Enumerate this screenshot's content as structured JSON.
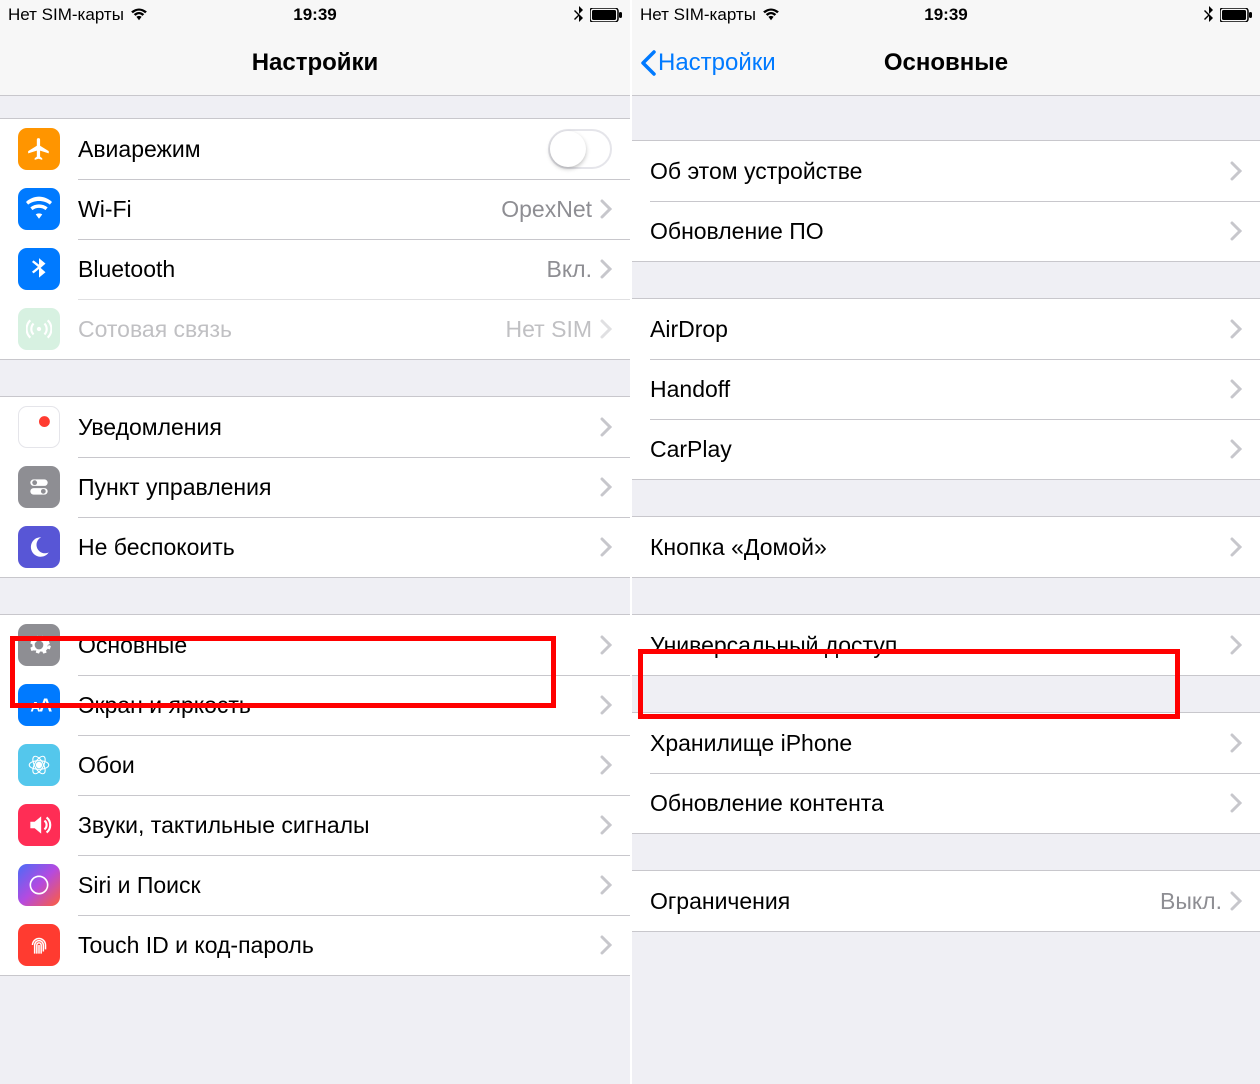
{
  "status": {
    "carrier": "Нет SIM-карты",
    "time": "19:39"
  },
  "left": {
    "title": "Настройки",
    "groups": [
      {
        "cells": [
          {
            "id": "airplane",
            "label": "Авиарежим",
            "kind": "toggle",
            "icon": "airplane",
            "color": "bg-orange"
          },
          {
            "id": "wifi",
            "label": "Wi-Fi",
            "kind": "link",
            "value": "OpexNet",
            "icon": "wifi",
            "color": "bg-blue"
          },
          {
            "id": "bluetooth",
            "label": "Bluetooth",
            "kind": "link",
            "value": "Вкл.",
            "icon": "bluetooth",
            "color": "bg-btblue"
          },
          {
            "id": "cellular",
            "label": "Сотовая связь",
            "kind": "link",
            "value": "Нет SIM",
            "icon": "cellular",
            "color": "bg-green",
            "dim": true
          }
        ]
      },
      {
        "cells": [
          {
            "id": "notifications",
            "label": "Уведомления",
            "kind": "link",
            "icon": "notif",
            "color": "bg-red"
          },
          {
            "id": "controlcenter",
            "label": "Пункт управления",
            "kind": "link",
            "icon": "control",
            "color": "bg-gray"
          },
          {
            "id": "dnd",
            "label": "Не беспокоить",
            "kind": "link",
            "icon": "moon",
            "color": "bg-purple"
          }
        ]
      },
      {
        "cells": [
          {
            "id": "general",
            "label": "Основные",
            "kind": "link",
            "icon": "gear",
            "color": "bg-gray",
            "highlight": true
          },
          {
            "id": "display",
            "label": "Экран и яркость",
            "kind": "link",
            "icon": "aa",
            "color": "bg-aa"
          },
          {
            "id": "wallpaper",
            "label": "Обои",
            "kind": "link",
            "icon": "flower",
            "color": "bg-lblue"
          },
          {
            "id": "sounds",
            "label": "Звуки, тактильные сигналы",
            "kind": "link",
            "icon": "sound",
            "color": "bg-redsound"
          },
          {
            "id": "siri",
            "label": "Siri и Поиск",
            "kind": "link",
            "icon": "siri",
            "color": "bg-siri"
          },
          {
            "id": "touchid",
            "label": "Touch ID и код-пароль",
            "kind": "link",
            "icon": "finger",
            "color": "bg-touch"
          }
        ]
      }
    ]
  },
  "right": {
    "back": "Настройки",
    "title": "Основные",
    "groups": [
      {
        "cells": [
          {
            "id": "about",
            "label": "Об этом устройстве",
            "kind": "link"
          },
          {
            "id": "update",
            "label": "Обновление ПО",
            "kind": "link"
          }
        ]
      },
      {
        "cells": [
          {
            "id": "airdrop",
            "label": "AirDrop",
            "kind": "link"
          },
          {
            "id": "handoff",
            "label": "Handoff",
            "kind": "link"
          },
          {
            "id": "carplay",
            "label": "CarPlay",
            "kind": "link"
          }
        ]
      },
      {
        "cells": [
          {
            "id": "home",
            "label": "Кнопка «Домой»",
            "kind": "link"
          }
        ]
      },
      {
        "cells": [
          {
            "id": "accessibility",
            "label": "Универсальный доступ",
            "kind": "link",
            "highlight": true
          }
        ]
      },
      {
        "cells": [
          {
            "id": "storage",
            "label": "Хранилище iPhone",
            "kind": "link"
          },
          {
            "id": "refresh",
            "label": "Обновление контента",
            "kind": "link"
          }
        ]
      },
      {
        "cells": [
          {
            "id": "restrict",
            "label": "Ограничения",
            "kind": "link",
            "value": "Выкл."
          }
        ]
      }
    ]
  }
}
